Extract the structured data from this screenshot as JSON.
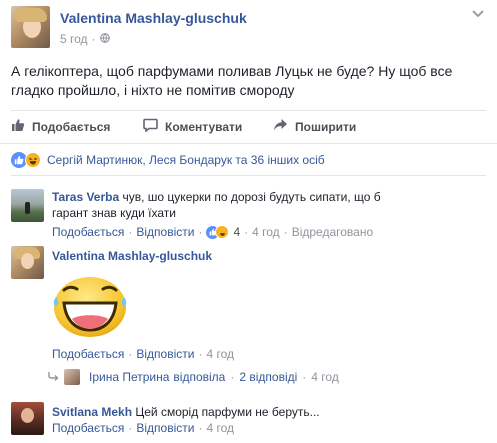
{
  "post": {
    "author": "Valentina Mashlay-gluschuk",
    "time": "5 год",
    "text": "А гелікоптера, щоб парфумами поливав Луцьк не буде? Ну щоб все гладко пройшло, і ніхто не помітив смороду"
  },
  "actions": {
    "like": "Подобається",
    "comment": "Коментувати",
    "share": "Поширити"
  },
  "reactions": {
    "summary": "Сергій Мартинюк, Леся Бондарук та 36 інших осіб"
  },
  "comments": [
    {
      "author": "Taras Verba",
      "text": "чув, шо цукерки по дорозі будуть сипати, що б гарант знав куди їхати",
      "like": "Подобається",
      "reply": "Відповісти",
      "reaction_count": "4",
      "time": "4 год",
      "edited": "Відредаговано"
    },
    {
      "author": "Valentina Mashlay-gluschuk",
      "sticker": "laughing-face-sticker",
      "like": "Подобається",
      "reply": "Відповісти",
      "time": "4 год",
      "replies_line": {
        "author": "Ірина Петрина",
        "action": "відповіла",
        "count": "2 відповіді",
        "time": "4 год"
      }
    },
    {
      "author": "Svitlana Mekh",
      "text": "Цей сморід парфуми не беруть...",
      "like": "Подобається",
      "reply": "Відповісти",
      "time": "4 год"
    }
  ],
  "separators": {
    "dot": "·"
  },
  "colors": {
    "link_blue": "#365899",
    "like_blue": "#5890ff",
    "haha_yellow": "#f7b125",
    "muted": "#90949c",
    "text": "#1d2129",
    "border": "#e5e5e5",
    "reactions_bg": "#f6f7f9"
  },
  "icons": [
    "globe-icon",
    "chevron-down-icon",
    "thumbs-up-icon",
    "comment-icon",
    "share-icon",
    "like-reaction-icon",
    "haha-reaction-icon",
    "reply-arrow-icon"
  ]
}
